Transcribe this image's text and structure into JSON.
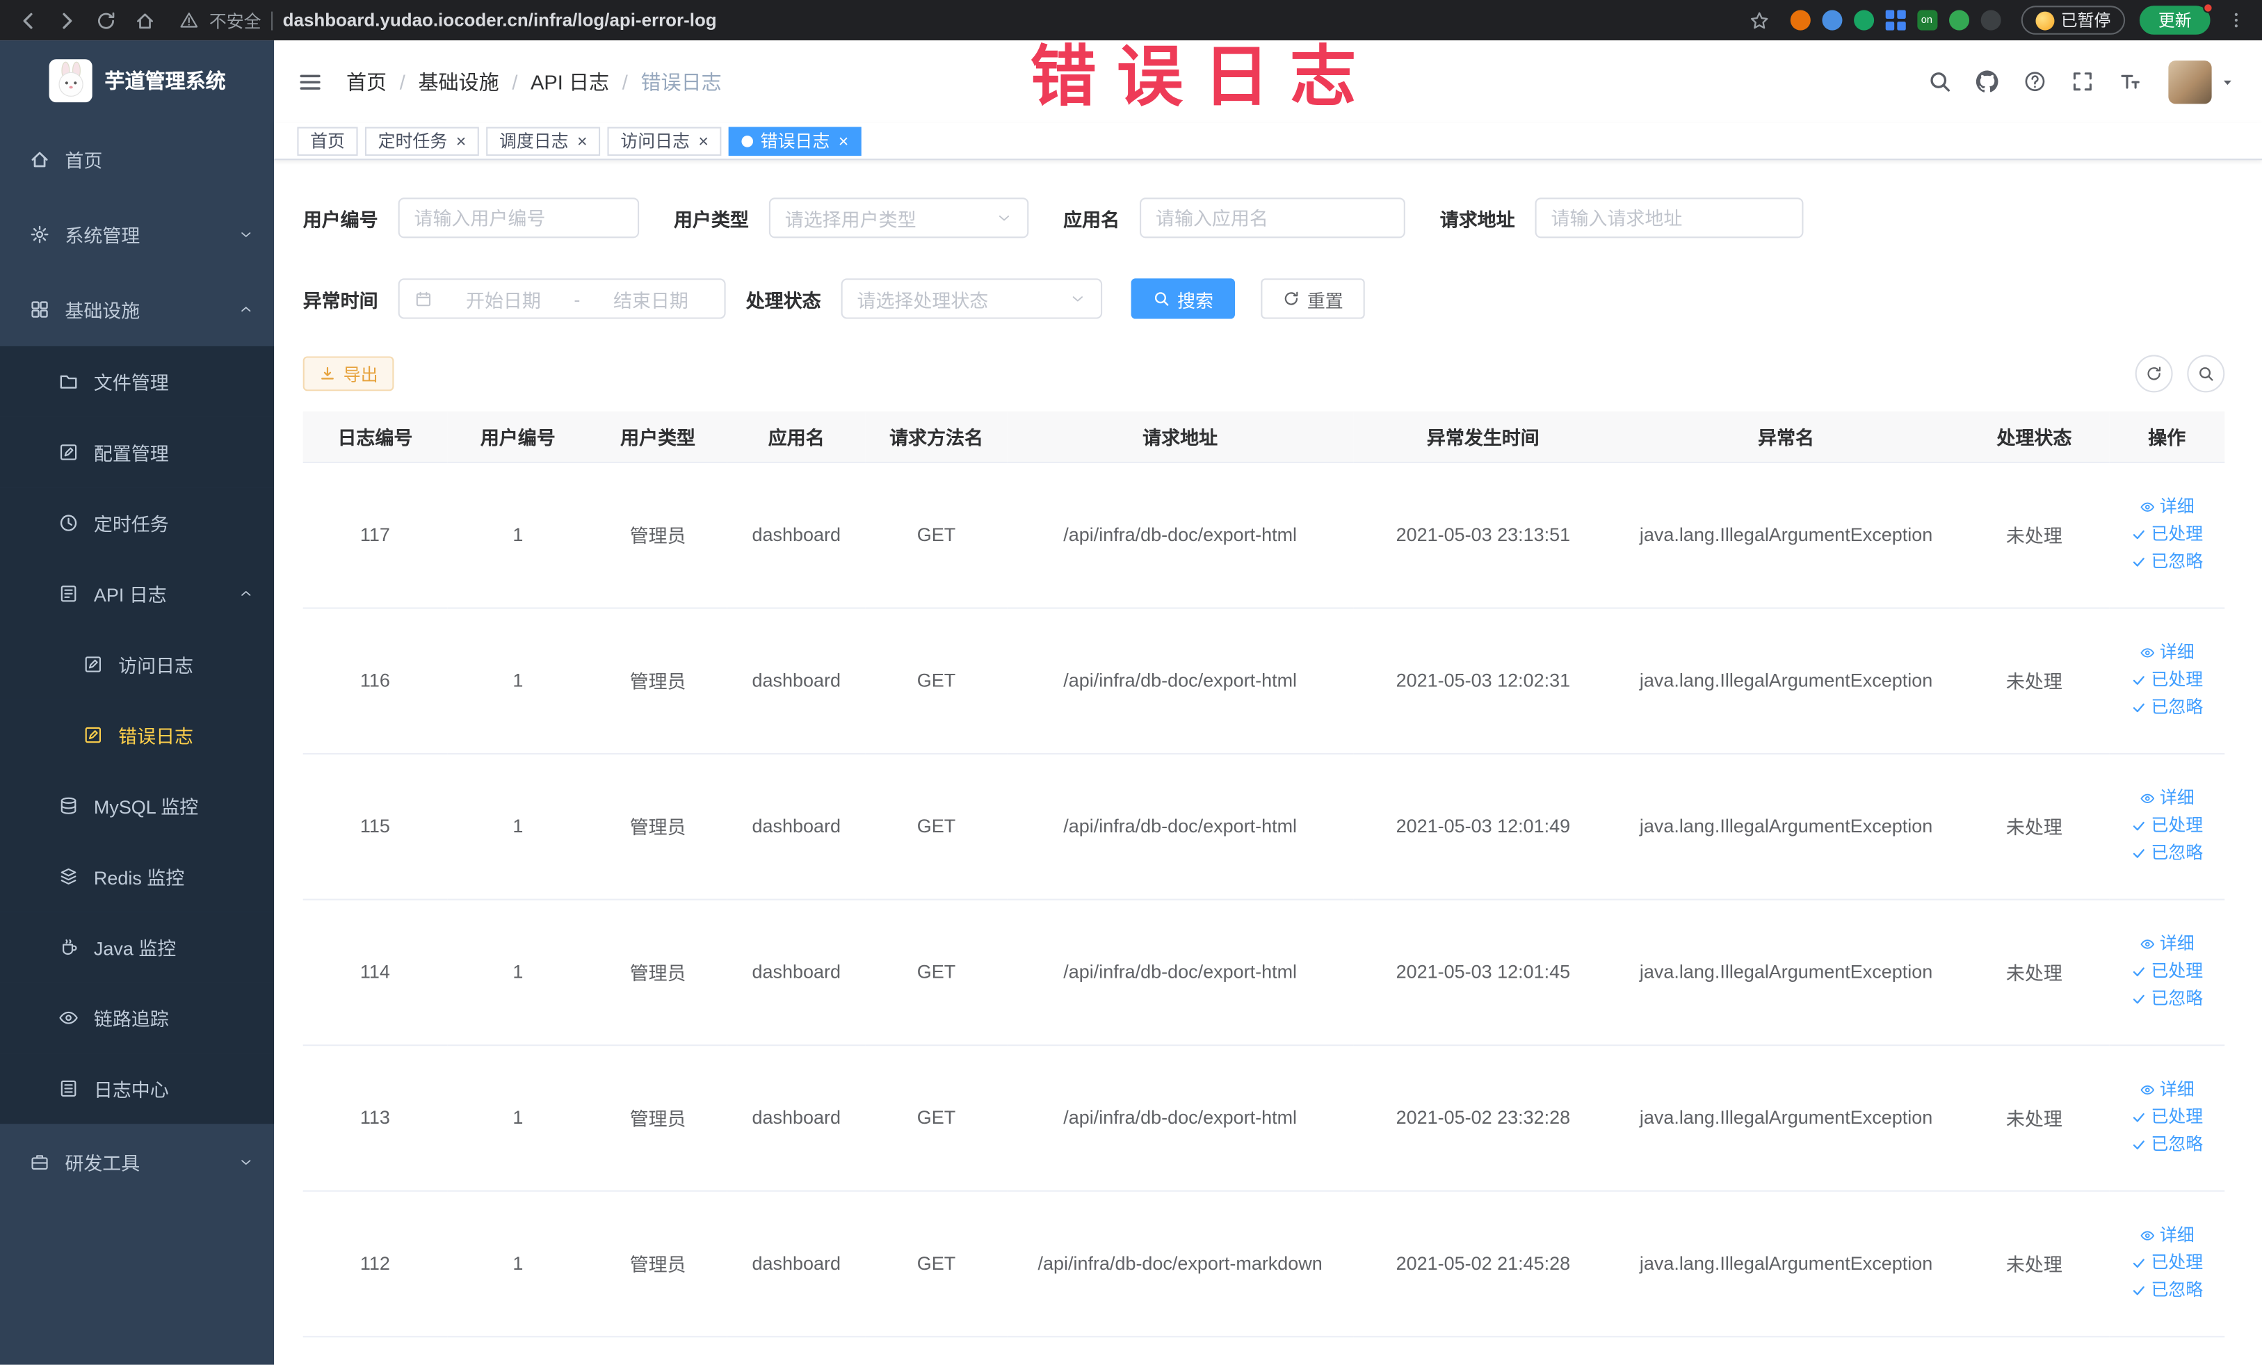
{
  "colors": {
    "accent_blue": "#409eff",
    "sidebar_bg": "#304156",
    "sidebar_submenu_bg": "#1f2d3d",
    "sidebar_active_text": "#ffd04b",
    "warning_orange": "#e6a23c",
    "annotation_red": "#ee3b57",
    "update_button_green": "#1e9e5a"
  },
  "annotation": {
    "text": "错误日志"
  },
  "browser": {
    "security_label": "不安全",
    "url": "dashboard.yudao.iocoder.cn/infra/log/api-error-log",
    "paused_badge_label": "已暂停",
    "update_button_label": "更新",
    "extensions": [
      {
        "name": "extension-icon-1",
        "color": "#e8710a",
        "shape": "circle",
        "label": ""
      },
      {
        "name": "extension-icon-2",
        "color": "#4a8fe2",
        "shape": "circle",
        "label": ""
      },
      {
        "name": "extension-icon-3",
        "color": "#19a463",
        "shape": "circle",
        "label": ""
      },
      {
        "name": "extension-icon-4",
        "color": "#4285f4",
        "shape": "grid",
        "label": ""
      },
      {
        "name": "extension-icon-5",
        "color": "#1e7e34",
        "shape": "square",
        "label": "on"
      },
      {
        "name": "extension-icon-6",
        "color": "#34a853",
        "shape": "circle",
        "label": ""
      },
      {
        "name": "extension-icon-7",
        "color": "#3c4043",
        "shape": "circle",
        "label": ""
      }
    ]
  },
  "sidebar": {
    "logo_title": "芋道管理系统",
    "menu": [
      {
        "name": "home",
        "label": "首页",
        "icon": "home-icon",
        "level": 1
      },
      {
        "name": "system-management",
        "label": "系统管理",
        "icon": "gear-icon",
        "level": 1,
        "arrow": "down"
      },
      {
        "name": "infrastructure",
        "label": "基础设施",
        "icon": "grid-icon",
        "level": 1,
        "arrow": "up"
      },
      {
        "name": "file-management",
        "label": "文件管理",
        "icon": "folder-icon",
        "level": 2
      },
      {
        "name": "config-management",
        "label": "配置管理",
        "icon": "edit-icon",
        "level": 2
      },
      {
        "name": "scheduled-tasks",
        "label": "定时任务",
        "icon": "clock-icon",
        "level": 2
      },
      {
        "name": "api-log",
        "label": "API 日志",
        "icon": "api-log-icon",
        "level": 2,
        "arrow": "up"
      },
      {
        "name": "access-log",
        "label": "访问日志",
        "icon": "doc-icon",
        "level": 3
      },
      {
        "name": "error-log",
        "label": "错误日志",
        "icon": "doc-icon",
        "level": 3,
        "active": true
      },
      {
        "name": "mysql-monitor",
        "label": "MySQL 监控",
        "icon": "database-icon",
        "level": 2
      },
      {
        "name": "redis-monitor",
        "label": "Redis 监控",
        "icon": "redis-icon",
        "level": 2
      },
      {
        "name": "java-monitor",
        "label": "Java 监控",
        "icon": "java-icon",
        "level": 2
      },
      {
        "name": "trace",
        "label": "链路追踪",
        "icon": "trace-icon",
        "level": 2
      },
      {
        "name": "log-center",
        "label": "日志中心",
        "icon": "log-center-icon",
        "level": 2
      },
      {
        "name": "dev-tools",
        "label": "研发工具",
        "icon": "tools-icon",
        "level": 1,
        "arrow": "down"
      }
    ]
  },
  "header": {
    "breadcrumb": [
      "首页",
      "基础设施",
      "API 日志",
      "错误日志"
    ],
    "breadcrumb_separator": "/"
  },
  "ui": {
    "tab_close_glyph": "×"
  },
  "tabs": [
    {
      "name": "home",
      "label": "首页",
      "closable": false,
      "active": false
    },
    {
      "name": "scheduled-tasks",
      "label": "定时任务",
      "closable": true,
      "active": false
    },
    {
      "name": "dispatch-log",
      "label": "调度日志",
      "closable": true,
      "active": false
    },
    {
      "name": "access-log",
      "label": "访问日志",
      "closable": true,
      "active": false
    },
    {
      "name": "error-log",
      "label": "错误日志",
      "closable": true,
      "active": true
    }
  ],
  "filters": {
    "user_id": {
      "label": "用户编号",
      "placeholder": "请输入用户编号"
    },
    "user_type": {
      "label": "用户类型",
      "placeholder": "请选择用户类型"
    },
    "app_name": {
      "label": "应用名",
      "placeholder": "请输入应用名"
    },
    "request_url": {
      "label": "请求地址",
      "placeholder": "请输入请求地址"
    },
    "exception_time": {
      "label": "异常时间",
      "start_placeholder": "开始日期",
      "separator": "-",
      "end_placeholder": "结束日期"
    },
    "process_status": {
      "label": "处理状态",
      "placeholder": "请选择处理状态"
    },
    "search_button": "搜索",
    "reset_button": "重置"
  },
  "toolbar": {
    "export_button": "导出"
  },
  "table": {
    "columns": [
      "日志编号",
      "用户编号",
      "用户类型",
      "应用名",
      "请求方法名",
      "请求地址",
      "异常发生时间",
      "异常名",
      "处理状态",
      "操作"
    ],
    "actions": [
      "详细",
      "已处理",
      "已忽略"
    ],
    "rows": [
      {
        "id": "117",
        "user_id": "1",
        "user_type": "管理员",
        "app": "dashboard",
        "method": "GET",
        "url": "/api/infra/db-doc/export-html",
        "time": "2021-05-03 23:13:51",
        "exception": "java.lang.IllegalArgumentException",
        "status": "未处理"
      },
      {
        "id": "116",
        "user_id": "1",
        "user_type": "管理员",
        "app": "dashboard",
        "method": "GET",
        "url": "/api/infra/db-doc/export-html",
        "time": "2021-05-03 12:02:31",
        "exception": "java.lang.IllegalArgumentException",
        "status": "未处理"
      },
      {
        "id": "115",
        "user_id": "1",
        "user_type": "管理员",
        "app": "dashboard",
        "method": "GET",
        "url": "/api/infra/db-doc/export-html",
        "time": "2021-05-03 12:01:49",
        "exception": "java.lang.IllegalArgumentException",
        "status": "未处理"
      },
      {
        "id": "114",
        "user_id": "1",
        "user_type": "管理员",
        "app": "dashboard",
        "method": "GET",
        "url": "/api/infra/db-doc/export-html",
        "time": "2021-05-03 12:01:45",
        "exception": "java.lang.IllegalArgumentException",
        "status": "未处理"
      },
      {
        "id": "113",
        "user_id": "1",
        "user_type": "管理员",
        "app": "dashboard",
        "method": "GET",
        "url": "/api/infra/db-doc/export-html",
        "time": "2021-05-02 23:32:28",
        "exception": "java.lang.IllegalArgumentException",
        "status": "未处理"
      },
      {
        "id": "112",
        "user_id": "1",
        "user_type": "管理员",
        "app": "dashboard",
        "method": "GET",
        "url": "/api/infra/db-doc/export-markdown",
        "time": "2021-05-02 21:45:28",
        "exception": "java.lang.IllegalArgumentException",
        "status": "未处理"
      }
    ]
  }
}
